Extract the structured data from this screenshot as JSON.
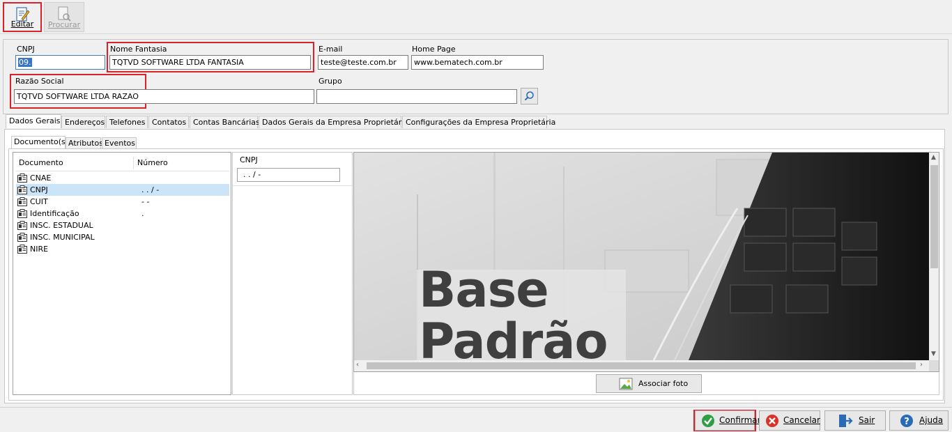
{
  "toolbar": {
    "edit_label": "Editar",
    "search_label": "Procurar"
  },
  "form": {
    "cnpj_label": "CNPJ",
    "cnpj_value": "09.",
    "fantasy_label": "Nome Fantasia",
    "fantasy_value": "TQTVD SOFTWARE LTDA FANTASIA",
    "email_label": "E-mail",
    "email_value": "teste@teste.com.br",
    "homepage_label": "Home Page",
    "homepage_value": "www.bematech.com.br",
    "razao_label": "Razão Social",
    "razao_value": "TQTVD SOFTWARE LTDA RAZAO",
    "group_label": "Grupo",
    "group_value": ""
  },
  "tabs": [
    "Dados Gerais",
    "Endereços",
    "Telefones",
    "Contatos",
    "Contas Bancárias",
    "Dados Gerais da Empresa Proprietária",
    "Configurações da Empresa Proprietária"
  ],
  "subtabs": [
    "Documento(s)",
    "Atributos",
    "Eventos"
  ],
  "documents": {
    "col_document": "Documento",
    "col_number": "Número",
    "rows": [
      {
        "name": "CNAE",
        "number": ""
      },
      {
        "name": "CNPJ",
        "number": ". . / -"
      },
      {
        "name": "CUIT",
        "number": "-       -"
      },
      {
        "name": "Identificação",
        "number": "."
      },
      {
        "name": "INSC. ESTADUAL",
        "number": ""
      },
      {
        "name": "INSC. MUNICIPAL",
        "number": ""
      },
      {
        "name": "NIRE",
        "number": ""
      }
    ]
  },
  "detail": {
    "cnpj_label": "CNPJ",
    "cnpj_mask": ". . / -"
  },
  "image": {
    "text_line1": "Base",
    "text_line2": "Padrão",
    "associate_label": "Associar foto"
  },
  "footer": {
    "confirm_label": "Confirmar",
    "cancel_label": "Cancelar",
    "exit_label": "Sair",
    "help_label": "Ajuda"
  },
  "colors": {
    "highlight_red": "#d9222a",
    "selection_blue": "#cce4f7",
    "confirm_green": "#2e9e44",
    "cancel_red": "#d9322a",
    "help_blue": "#2a6bb8"
  }
}
